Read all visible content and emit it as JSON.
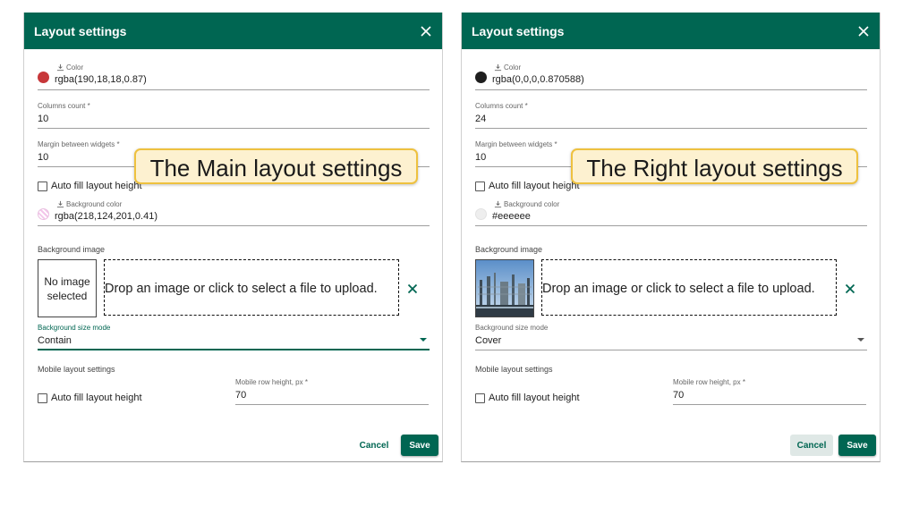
{
  "left_dialog": {
    "title": "Layout settings",
    "color_label": "Color",
    "color_value": "rgba(190,18,18,0.87)",
    "color_swatch": "#c7373a",
    "columns_label": "Columns count *",
    "columns_value": "10",
    "margin_label": "Margin between widgets *",
    "margin_value": "10",
    "autofill_label": "Auto fill layout height",
    "bg_color_label": "Background color",
    "bg_color_value": "rgba(218,124,201,0.41)",
    "bg_color_swatch": "#f0c8e8",
    "bg_image_label": "Background image",
    "no_image_text": "No image selected",
    "dropzone_text": "Drop an image or click to select a file to upload.",
    "size_mode_label": "Background size mode",
    "size_mode_value": "Contain",
    "mobile_section": "Mobile layout settings",
    "mobile_autofill_label": "Auto fill layout height",
    "mobile_row_height_label": "Mobile row height, px *",
    "mobile_row_height_value": "70",
    "cancel_label": "Cancel",
    "save_label": "Save"
  },
  "right_dialog": {
    "title": "Layout settings",
    "color_label": "Color",
    "color_value": "rgba(0,0,0,0.870588)",
    "color_swatch": "#212121",
    "columns_label": "Columns count *",
    "columns_value": "24",
    "margin_label": "Margin between widgets *",
    "margin_value": "10",
    "autofill_label": "Auto fill layout height",
    "bg_color_label": "Background color",
    "bg_color_value": "#eeeeee",
    "bg_color_swatch": "#eeeeee",
    "bg_image_label": "Background image",
    "dropzone_text": "Drop an image or click to select a file to upload.",
    "size_mode_label": "Background size mode",
    "size_mode_value": "Cover",
    "mobile_section": "Mobile layout settings",
    "mobile_autofill_label": "Auto fill layout height",
    "mobile_row_height_label": "Mobile row height, px *",
    "mobile_row_height_value": "70",
    "cancel_label": "Cancel",
    "save_label": "Save"
  },
  "callouts": {
    "main": "The Main layout settings",
    "right": "The Right layout settings"
  },
  "colors": {
    "accent": "#006652",
    "callout_bg": "#fdf1d0",
    "callout_border": "#eec13f"
  },
  "icons": [
    "close-icon",
    "download-icon",
    "clear-icon",
    "dropdown-arrow-icon",
    "checkbox-icon"
  ]
}
